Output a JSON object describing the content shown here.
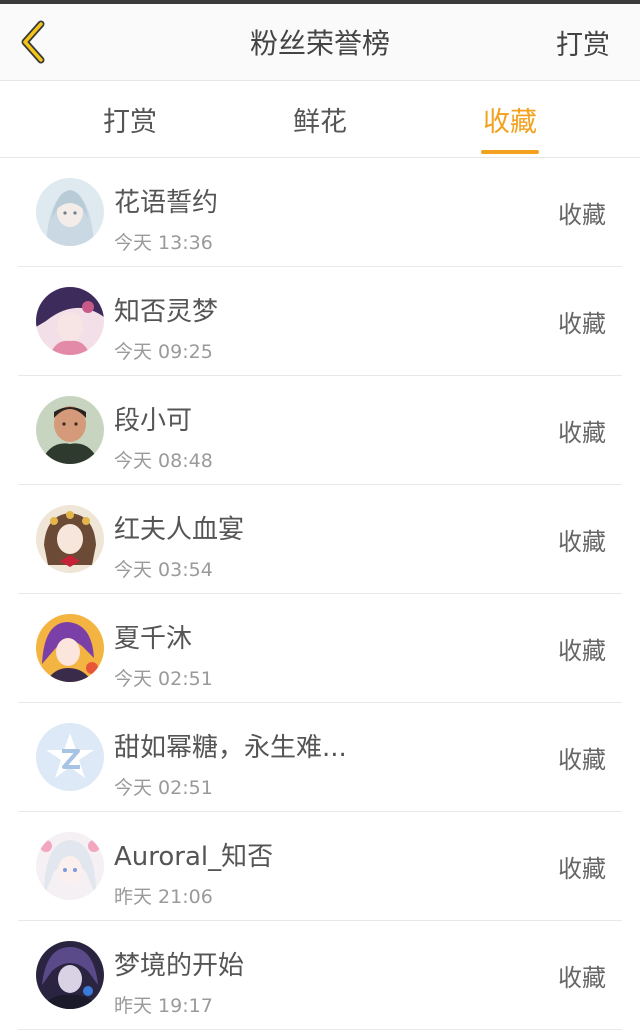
{
  "header": {
    "title": "粉丝荣誉榜",
    "right_action": "打赏",
    "accent_color": "#f2a21f"
  },
  "tabs": [
    {
      "label": "打赏",
      "active": false
    },
    {
      "label": "鲜花",
      "active": false
    },
    {
      "label": "收藏",
      "active": true
    }
  ],
  "fans": [
    {
      "name": "花语誓约",
      "time": "今天 13:36",
      "action": "收藏",
      "avatar": "anime-girl-white-hair"
    },
    {
      "name": "知否灵梦",
      "time": "今天 09:25",
      "action": "收藏",
      "avatar": "anime-girl-pink"
    },
    {
      "name": "段小可",
      "time": "今天 08:48",
      "action": "收藏",
      "avatar": "child-photo"
    },
    {
      "name": "红夫人血宴",
      "time": "今天 03:54",
      "action": "收藏",
      "avatar": "anime-girl-flowers"
    },
    {
      "name": "夏千沐",
      "time": "今天 02:51",
      "action": "收藏",
      "avatar": "anime-girl-purple"
    },
    {
      "name": "甜如幂糖，永生难...",
      "time": "今天 02:51",
      "action": "收藏",
      "avatar": "default-z-icon"
    },
    {
      "name": "Auroral_知否",
      "time": "昨天 21:06",
      "action": "收藏",
      "avatar": "anime-girl-silver"
    },
    {
      "name": "梦境的开始",
      "time": "昨天 19:17",
      "action": "收藏",
      "avatar": "anime-boy-dark"
    }
  ]
}
